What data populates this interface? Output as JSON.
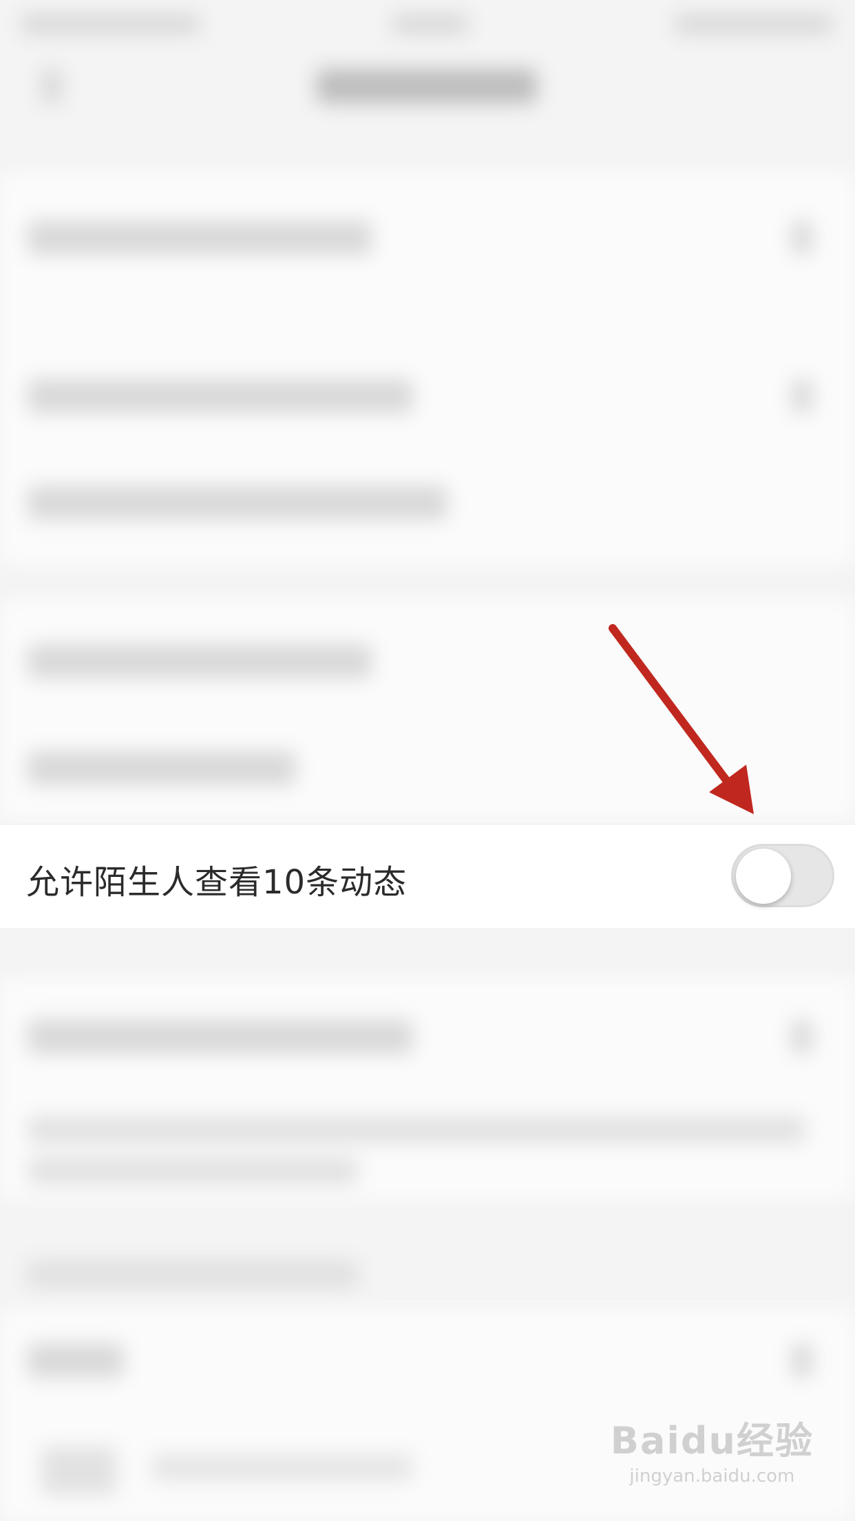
{
  "setting": {
    "label": "允许陌生人查看10条动态",
    "enabled": false
  },
  "colors": {
    "arrow": "#c0281f",
    "toggle_off": "#e6e6e6"
  },
  "watermark": {
    "logo": "Baidu经验",
    "url": "jingyan.baidu.com"
  }
}
